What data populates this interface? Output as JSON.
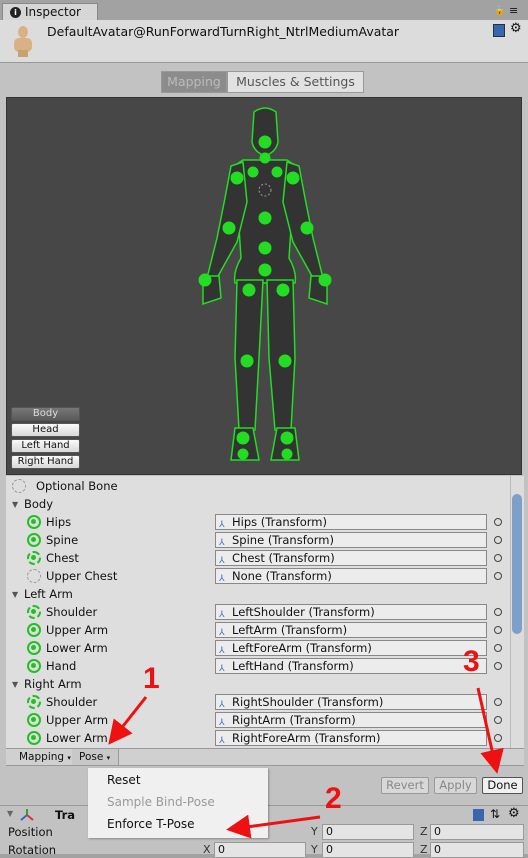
{
  "tab": {
    "label": "Inspector"
  },
  "header": {
    "title": "DefaultAvatar@RunForwardTurnRight_NtrlMediumAvatar"
  },
  "modes": [
    "Mapping",
    "Muscles & Settings"
  ],
  "parts": [
    "Body",
    "Head",
    "Left Hand",
    "Right Hand"
  ],
  "legend": "Optional Bone",
  "groups": [
    {
      "name": "Body",
      "bones": [
        {
          "name": "Hips",
          "value": "Hips (Transform)",
          "state": "solid"
        },
        {
          "name": "Spine",
          "value": "Spine (Transform)",
          "state": "solid"
        },
        {
          "name": "Chest",
          "value": "Chest (Transform)",
          "state": "dashed"
        },
        {
          "name": "Upper Chest",
          "value": "None (Transform)",
          "state": "empty"
        }
      ]
    },
    {
      "name": "Left Arm",
      "bones": [
        {
          "name": "Shoulder",
          "value": "LeftShoulder (Transform)",
          "state": "dashed"
        },
        {
          "name": "Upper Arm",
          "value": "LeftArm (Transform)",
          "state": "solid"
        },
        {
          "name": "Lower Arm",
          "value": "LeftForeArm (Transform)",
          "state": "solid"
        },
        {
          "name": "Hand",
          "value": "LeftHand (Transform)",
          "state": "solid"
        }
      ]
    },
    {
      "name": "Right Arm",
      "bones": [
        {
          "name": "Shoulder",
          "value": "RightShoulder (Transform)",
          "state": "dashed"
        },
        {
          "name": "Upper Arm",
          "value": "RightArm (Transform)",
          "state": "solid"
        },
        {
          "name": "Lower Arm",
          "value": "RightForeArm (Transform)",
          "state": "solid"
        }
      ]
    }
  ],
  "toolbar": {
    "mapping": "Mapping",
    "pose": "Pose"
  },
  "pose_menu": {
    "reset": "Reset",
    "sample": "Sample Bind-Pose",
    "enforce": "Enforce T-Pose"
  },
  "actions": {
    "revert": "Revert",
    "apply": "Apply",
    "done": "Done"
  },
  "transform": {
    "title": "Tra",
    "position": {
      "label": "Position",
      "y": "0",
      "z": "0"
    },
    "rotation": {
      "label": "Rotation",
      "x": "0",
      "y": "0",
      "z": "0"
    },
    "axes": {
      "x": "X",
      "y": "Y",
      "z": "Z"
    }
  },
  "annotations": {
    "one": "1",
    "two": "2",
    "three": "3"
  },
  "colors": {
    "bone": "#22c022",
    "annotation": "#ee1111"
  }
}
